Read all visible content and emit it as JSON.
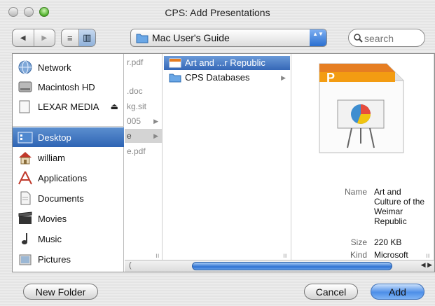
{
  "window": {
    "title": "CPS: Add Presentations"
  },
  "toolbar": {
    "back_glyph": "◀",
    "forward_glyph": "▶",
    "list_view_glyph": "≡",
    "column_view_glyph": "▥",
    "path": "Mac User's Guide",
    "popup_glyph": "▲▼",
    "search_placeholder": "search"
  },
  "sidebar": {
    "devices": [
      {
        "label": "Network",
        "icon": "network-globe-icon"
      },
      {
        "label": "Macintosh HD",
        "icon": "hard-drive-icon"
      },
      {
        "label": "LEXAR MEDIA",
        "icon": "removable-disk-icon",
        "eject": "⏏"
      }
    ],
    "places": [
      {
        "label": "Desktop",
        "icon": "desktop-icon",
        "selected": true
      },
      {
        "label": "william",
        "icon": "home-icon"
      },
      {
        "label": "Applications",
        "icon": "applications-icon"
      },
      {
        "label": "Documents",
        "icon": "documents-icon"
      },
      {
        "label": "Movies",
        "icon": "movies-icon"
      },
      {
        "label": "Music",
        "icon": "music-icon"
      },
      {
        "label": "Pictures",
        "icon": "pictures-icon"
      }
    ]
  },
  "columns": {
    "col1": [
      "r.pdf",
      ".doc",
      "kg.sit",
      "005",
      "e",
      "e.pdf"
    ],
    "col2": [
      {
        "label": "Art and ...r Republic",
        "selected": true,
        "icon": "presentation-file-icon"
      },
      {
        "label": "CPS Databases",
        "selected": false,
        "icon": "folder-icon"
      }
    ]
  },
  "preview": {
    "name_key": "Name",
    "name_value": "Art and Culture of the Weimar Republic",
    "size_key": "Size",
    "size_value": "220 KB",
    "kind_key": "Kind",
    "kind_value": "Microsoft"
  },
  "buttons": {
    "new_folder": "New Folder",
    "cancel": "Cancel",
    "add": "Add"
  },
  "colors": {
    "selection": "#3567b7",
    "default_button": "#4d8ee8"
  }
}
